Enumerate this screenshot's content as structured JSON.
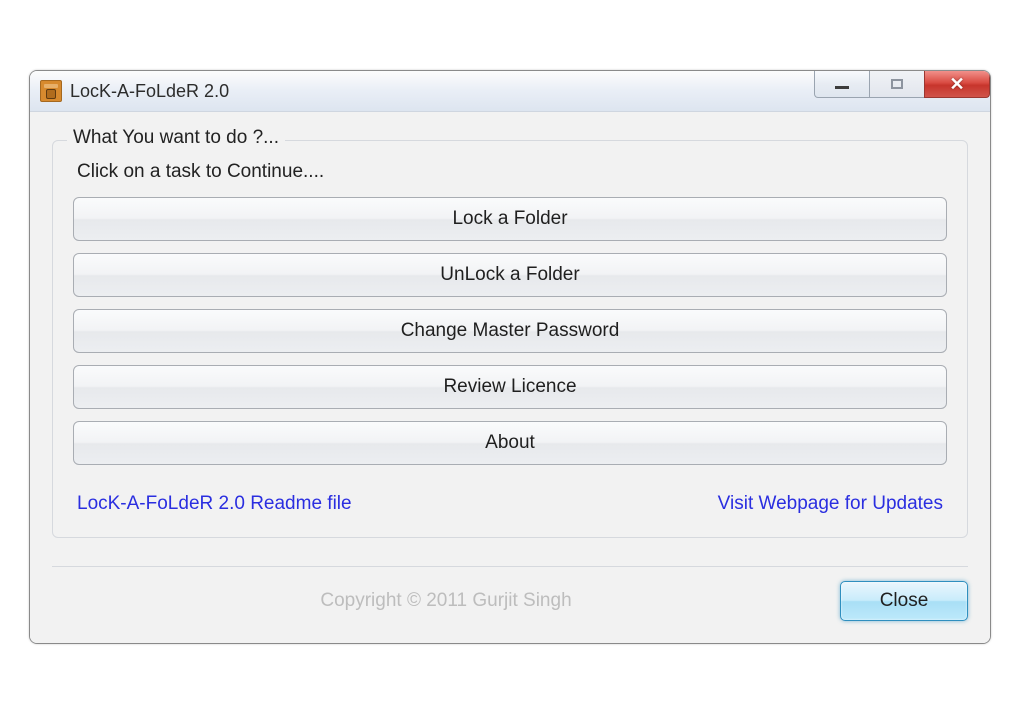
{
  "window": {
    "title": "LocK-A-FoLdeR 2.0"
  },
  "group": {
    "legend": "What You want to do ?...",
    "subtitle": "Click on a task to Continue....",
    "buttons": {
      "lock": "Lock a Folder",
      "unlock": "UnLock a Folder",
      "changepw": "Change Master Password",
      "licence": "Review Licence",
      "about": "About"
    },
    "links": {
      "readme": "LocK-A-FoLdeR 2.0 Readme file",
      "updates": "Visit Webpage for Updates"
    }
  },
  "footer": {
    "copyright": "Copyright © 2011 Gurjit Singh",
    "close": "Close"
  }
}
